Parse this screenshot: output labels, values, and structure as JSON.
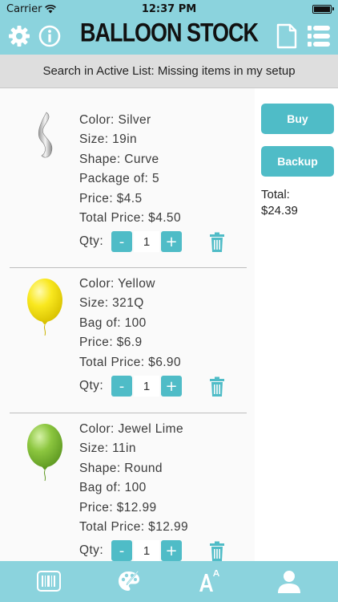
{
  "status_bar": {
    "carrier": "Carrier",
    "time": "12:37 PM",
    "wifi_icon": "wifi-icon",
    "battery_icon": "battery-icon"
  },
  "nav": {
    "title": "BALLOON STOCK",
    "left_icons": [
      "gear-icon",
      "info-icon"
    ],
    "right_icons": [
      "document-icon",
      "list-icon"
    ]
  },
  "search": {
    "text": "Search in Active List: Missing items in my setup"
  },
  "items": [
    {
      "image": "silver-curve-balloon-icon",
      "lines": [
        "Color: Silver",
        "Size: 19in",
        "Shape: Curve",
        "Package of: 5",
        "Price: $4.5",
        "Total Price: $4.50"
      ],
      "qty_label": "Qty:",
      "qty": "1",
      "minus": "-",
      "plus": "+"
    },
    {
      "image": "yellow-balloon-icon",
      "lines": [
        "Color: Yellow",
        "Size: 321Q",
        "Bag of: 100",
        "Price: $6.9",
        "Total Price: $6.90"
      ],
      "qty_label": "Qty:",
      "qty": "1",
      "minus": "-",
      "plus": "+"
    },
    {
      "image": "lime-balloon-icon",
      "lines": [
        "Color: Jewel Lime",
        "Size: 11in",
        "Shape: Round",
        "Bag of: 100",
        "Price: $12.99",
        "Total Price: $12.99"
      ],
      "qty_label": "Qty:",
      "qty": "1",
      "minus": "-",
      "plus": "+"
    }
  ],
  "side": {
    "buy_label": "Buy",
    "backup_label": "Backup",
    "total_label": "Total:",
    "total_value": "$24.39"
  },
  "tabs": [
    "barcode-icon",
    "palette-icon",
    "font-size-icon",
    "user-icon"
  ],
  "colors": {
    "bar": "#8bd3dd",
    "accent": "#4fbcc7",
    "yellow_balloon": "#f9e81f",
    "lime_balloon": "#8cc63f"
  }
}
